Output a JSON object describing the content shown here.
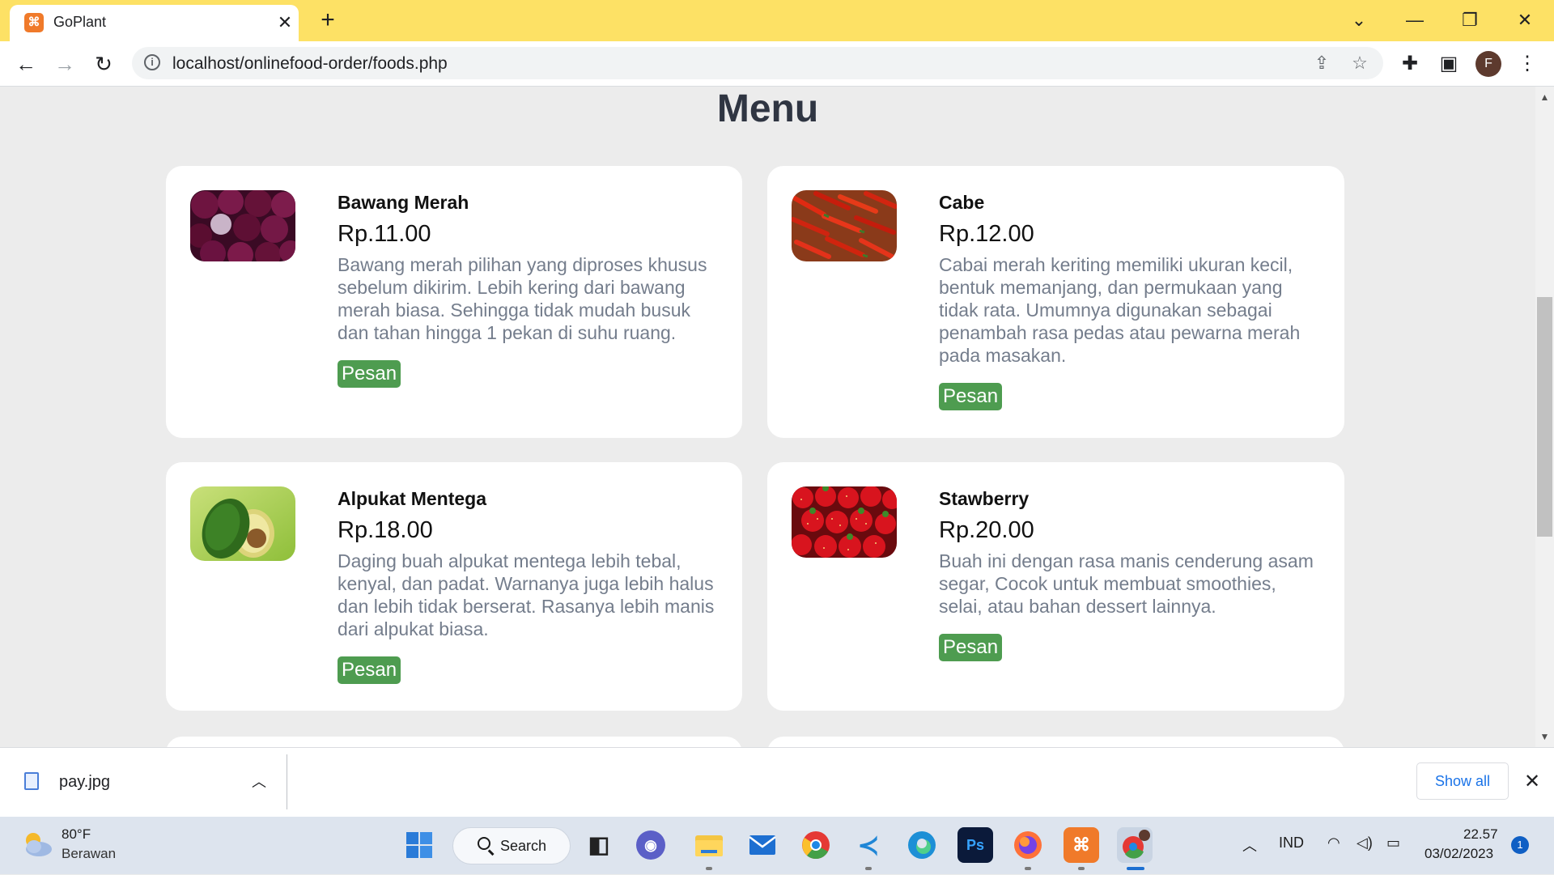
{
  "browser": {
    "tab_title": "GoPlant",
    "tab_favicon": "xampp-icon",
    "url": "localhost/onlinefood-order/foods.php",
    "profile_initial": "F"
  },
  "page": {
    "heading": "Menu",
    "foods": [
      {
        "name": "Bawang Merah",
        "price": "Rp.11.00",
        "description": "Bawang merah pilihan yang diproses khusus sebelum dikirim. Lebih kering dari bawang merah biasa. Sehingga tidak mudah busuk dan tahan hingga 1 pekan di suhu ruang.",
        "button": "Pesan",
        "image": "red-onions-photo"
      },
      {
        "name": "Cabe",
        "price": "Rp.12.00",
        "description": "Cabai merah keriting memiliki ukuran kecil, bentuk memanjang, dan permukaan yang tidak rata. Umumnya digunakan sebagai penambah rasa pedas atau pewarna merah pada masakan.",
        "button": "Pesan",
        "image": "red-chili-photo"
      },
      {
        "name": "Alpukat Mentega",
        "price": "Rp.18.00",
        "description": "Daging buah alpukat mentega lebih tebal, kenyal, dan padat. Warnanya juga lebih halus dan lebih tidak berserat. Rasanya lebih manis dari alpukat biasa.",
        "button": "Pesan",
        "image": "avocado-photo"
      },
      {
        "name": "Stawberry",
        "price": "Rp.20.00",
        "description": "Buah ini dengan rasa manis cenderung asam segar, Cocok untuk membuat smoothies, selai, atau bahan dessert lainnya.",
        "button": "Pesan",
        "image": "strawberry-photo"
      }
    ]
  },
  "downloads": {
    "file_name": "pay.jpg",
    "show_all": "Show all"
  },
  "taskbar": {
    "weather_temp": "80°F",
    "weather_desc": "Berawan",
    "search_label": "Search",
    "language": "IND",
    "time": "22.57",
    "date": "03/02/2023",
    "notification_count": "1",
    "photoshop_label": "Ps"
  },
  "colors": {
    "tab_strip": "#fde165",
    "order_button": "#4e9c50",
    "page_background": "#ececec",
    "description_text": "#747d8c"
  }
}
